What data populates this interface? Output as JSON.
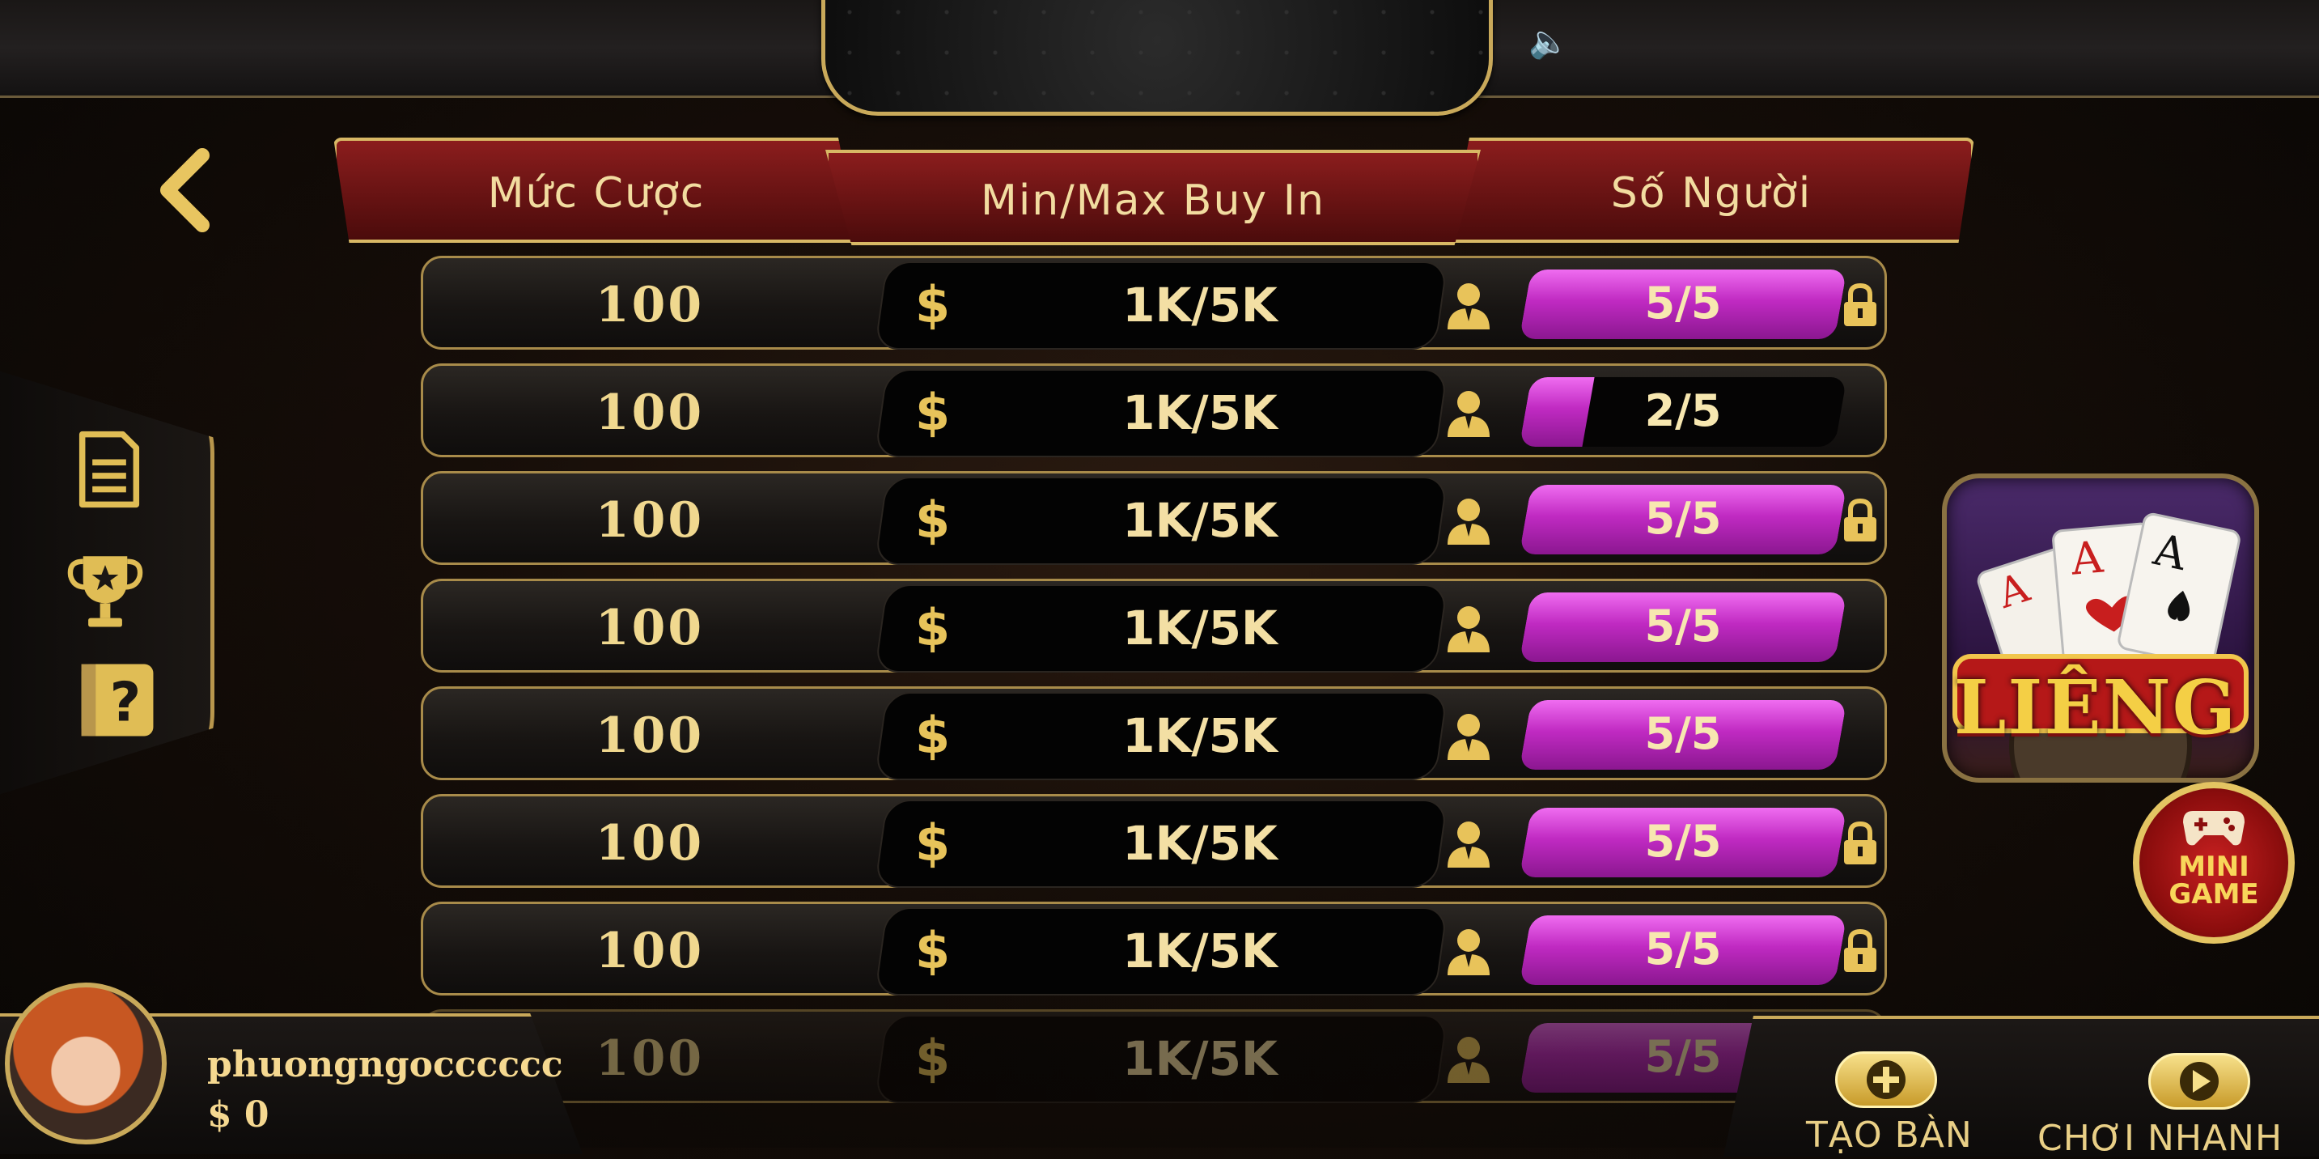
{
  "header": {
    "col_bet": "Mức Cược",
    "col_buyin": "Min/Max Buy In",
    "col_players": "Số Người"
  },
  "rows": [
    {
      "bet": "100",
      "buyin": "1K/5K",
      "seats": "5/5",
      "fill": 1.0,
      "locked": true
    },
    {
      "bet": "100",
      "buyin": "1K/5K",
      "seats": "2/5",
      "fill": 0.2,
      "locked": false
    },
    {
      "bet": "100",
      "buyin": "1K/5K",
      "seats": "5/5",
      "fill": 1.0,
      "locked": true
    },
    {
      "bet": "100",
      "buyin": "1K/5K",
      "seats": "5/5",
      "fill": 1.0,
      "locked": false
    },
    {
      "bet": "100",
      "buyin": "1K/5K",
      "seats": "5/5",
      "fill": 1.0,
      "locked": false
    },
    {
      "bet": "100",
      "buyin": "1K/5K",
      "seats": "5/5",
      "fill": 1.0,
      "locked": true
    },
    {
      "bet": "100",
      "buyin": "1K/5K",
      "seats": "5/5",
      "fill": 1.0,
      "locked": true
    },
    {
      "bet": "100",
      "buyin": "1K/5K",
      "seats": "5/5",
      "fill": 1.0,
      "locked": false
    }
  ],
  "currency_symbol": "$",
  "game": {
    "title": "LIÊNG"
  },
  "mini_game": {
    "line1": "MINI",
    "line2": "GAME"
  },
  "user": {
    "name": "phuongngocccccc",
    "balance": "$ 0"
  },
  "actions": {
    "create_table": "TẠO BÀN",
    "quick_play": "CHƠI NHANH"
  },
  "colors": {
    "gold": "#c9a95a",
    "magenta": "#c02ac2",
    "header_red": "#8b1d1d"
  }
}
